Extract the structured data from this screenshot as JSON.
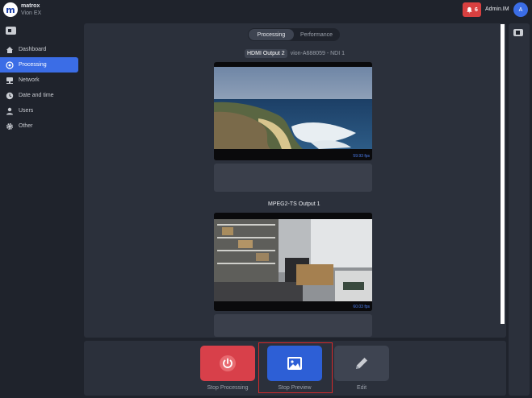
{
  "header": {
    "brand": "matrox",
    "product": "Vion EX",
    "logo_letter": "m",
    "alert_count": "6",
    "user_name": "Admin.IM",
    "avatar_letter": "A"
  },
  "sidebar": {
    "items": [
      {
        "label": "Dashboard",
        "icon": "home-icon"
      },
      {
        "label": "Processing",
        "icon": "processing-icon",
        "active": true
      },
      {
        "label": "Network",
        "icon": "network-icon"
      },
      {
        "label": "Date and time",
        "icon": "clock-icon"
      },
      {
        "label": "Users",
        "icon": "user-icon"
      },
      {
        "label": "Other",
        "icon": "gear-icon"
      }
    ]
  },
  "tabs": [
    {
      "label": "Processing",
      "active": true
    },
    {
      "label": "Performance",
      "active": false
    }
  ],
  "outputs": [
    {
      "title": "HDMI Output 2",
      "subtitle": "vion-A688059 - NDI 1",
      "fps": "59.93 fps"
    },
    {
      "title": "MPEG2-TS Output 1",
      "subtitle": "",
      "fps": "60.03 fps"
    }
  ],
  "actions": {
    "stop_processing": "Stop Processing",
    "stop_preview": "Stop Preview",
    "edit": "Edit"
  },
  "colors": {
    "accent": "#3b6de6",
    "danger": "#d84040",
    "background": "#1f232c",
    "panel": "#2b303b"
  }
}
